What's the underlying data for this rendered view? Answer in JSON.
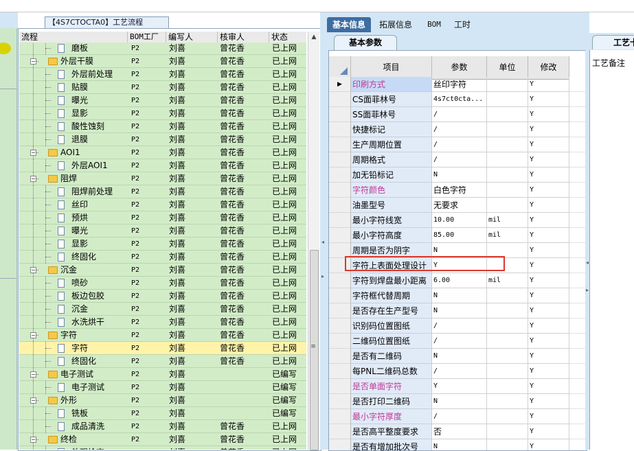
{
  "left_panel": {
    "tab_title": "【4S7CTOCTA0】工艺流程"
  },
  "tree": {
    "headers": [
      "流程",
      "BOM工厂",
      "编写人",
      "核审人",
      "状态"
    ],
    "rows": [
      {
        "level": 2,
        "kind": "doc",
        "name": "磨板",
        "bom": "P2",
        "author": "刘喜",
        "reviewer": "曾花香",
        "status": "已上网"
      },
      {
        "level": 1,
        "kind": "folder",
        "name": "外层干膜",
        "bom": "P2",
        "author": "刘喜",
        "reviewer": "曾花香",
        "status": "已上网"
      },
      {
        "level": 2,
        "kind": "doc",
        "name": "外层前处理",
        "bom": "P2",
        "author": "刘喜",
        "reviewer": "曾花香",
        "status": "已上网"
      },
      {
        "level": 2,
        "kind": "doc",
        "name": "贴膜",
        "bom": "P2",
        "author": "刘喜",
        "reviewer": "曾花香",
        "status": "已上网"
      },
      {
        "level": 2,
        "kind": "doc",
        "name": "曝光",
        "bom": "P2",
        "author": "刘喜",
        "reviewer": "曾花香",
        "status": "已上网"
      },
      {
        "level": 2,
        "kind": "doc",
        "name": "显影",
        "bom": "P2",
        "author": "刘喜",
        "reviewer": "曾花香",
        "status": "已上网"
      },
      {
        "level": 2,
        "kind": "doc",
        "name": "酸性蚀刻",
        "bom": "P2",
        "author": "刘喜",
        "reviewer": "曾花香",
        "status": "已上网"
      },
      {
        "level": 2,
        "kind": "doc",
        "name": "退膜",
        "bom": "P2",
        "author": "刘喜",
        "reviewer": "曾花香",
        "status": "已上网"
      },
      {
        "level": 1,
        "kind": "folder",
        "name": "AOI1",
        "bom": "P2",
        "author": "刘喜",
        "reviewer": "曾花香",
        "status": "已上网"
      },
      {
        "level": 2,
        "kind": "doc",
        "name": "外层AOI1",
        "bom": "P2",
        "author": "刘喜",
        "reviewer": "曾花香",
        "status": "已上网"
      },
      {
        "level": 1,
        "kind": "folder",
        "name": "阻焊",
        "bom": "P2",
        "author": "刘喜",
        "reviewer": "曾花香",
        "status": "已上网"
      },
      {
        "level": 2,
        "kind": "doc",
        "name": "阻焊前处理",
        "bom": "P2",
        "author": "刘喜",
        "reviewer": "曾花香",
        "status": "已上网"
      },
      {
        "level": 2,
        "kind": "doc",
        "name": "丝印",
        "bom": "P2",
        "author": "刘喜",
        "reviewer": "曾花香",
        "status": "已上网"
      },
      {
        "level": 2,
        "kind": "doc",
        "name": "预烘",
        "bom": "P2",
        "author": "刘喜",
        "reviewer": "曾花香",
        "status": "已上网"
      },
      {
        "level": 2,
        "kind": "doc",
        "name": "曝光",
        "bom": "P2",
        "author": "刘喜",
        "reviewer": "曾花香",
        "status": "已上网"
      },
      {
        "level": 2,
        "kind": "doc",
        "name": "显影",
        "bom": "P2",
        "author": "刘喜",
        "reviewer": "曾花香",
        "status": "已上网"
      },
      {
        "level": 2,
        "kind": "doc",
        "name": "终固化",
        "bom": "P2",
        "author": "刘喜",
        "reviewer": "曾花香",
        "status": "已上网"
      },
      {
        "level": 1,
        "kind": "folder",
        "name": "沉金",
        "bom": "P2",
        "author": "刘喜",
        "reviewer": "曾花香",
        "status": "已上网"
      },
      {
        "level": 2,
        "kind": "doc",
        "name": "喷砂",
        "bom": "P2",
        "author": "刘喜",
        "reviewer": "曾花香",
        "status": "已上网"
      },
      {
        "level": 2,
        "kind": "doc",
        "name": "板边包胶",
        "bom": "P2",
        "author": "刘喜",
        "reviewer": "曾花香",
        "status": "已上网"
      },
      {
        "level": 2,
        "kind": "doc",
        "name": "沉金",
        "bom": "P2",
        "author": "刘喜",
        "reviewer": "曾花香",
        "status": "已上网"
      },
      {
        "level": 2,
        "kind": "doc",
        "name": "水洗烘干",
        "bom": "P2",
        "author": "刘喜",
        "reviewer": "曾花香",
        "status": "已上网"
      },
      {
        "level": 1,
        "kind": "folder",
        "name": "字符",
        "bom": "P2",
        "author": "刘喜",
        "reviewer": "曾花香",
        "status": "已上网"
      },
      {
        "level": 2,
        "kind": "doc",
        "name": "字符",
        "bom": "P2",
        "author": "刘喜",
        "reviewer": "曾花香",
        "status": "已上网",
        "selected": true
      },
      {
        "level": 2,
        "kind": "doc",
        "name": "终固化",
        "bom": "P2",
        "author": "刘喜",
        "reviewer": "曾花香",
        "status": "已上网"
      },
      {
        "level": 1,
        "kind": "folder",
        "name": "电子测试",
        "bom": "P2",
        "author": "刘喜",
        "reviewer": "",
        "status": "已编写"
      },
      {
        "level": 2,
        "kind": "doc",
        "name": "电子测试",
        "bom": "P2",
        "author": "刘喜",
        "reviewer": "",
        "status": "已编写"
      },
      {
        "level": 1,
        "kind": "folder",
        "name": "外形",
        "bom": "P2",
        "author": "刘喜",
        "reviewer": "",
        "status": "已编写"
      },
      {
        "level": 2,
        "kind": "doc",
        "name": "铣板",
        "bom": "P2",
        "author": "刘喜",
        "reviewer": "",
        "status": "已编写"
      },
      {
        "level": 2,
        "kind": "doc",
        "name": "成品清洗",
        "bom": "P2",
        "author": "刘喜",
        "reviewer": "曾花香",
        "status": "已上网"
      },
      {
        "level": 1,
        "kind": "folder",
        "name": "终检",
        "bom": "P2",
        "author": "刘喜",
        "reviewer": "曾花香",
        "status": "已上网"
      },
      {
        "level": 2,
        "kind": "doc",
        "name": "外观检查",
        "bom": "P2",
        "author": "刘喜",
        "reviewer": "曾花香",
        "status": "已上网"
      }
    ]
  },
  "right_panel": {
    "tabs": [
      "基本信息",
      "拓展信息",
      "BOM",
      "工时"
    ],
    "subtab": "基本参数",
    "grid_headers": [
      "项目",
      "参数",
      "单位",
      "修改"
    ],
    "rows": [
      {
        "item": "印刷方式",
        "param": "丝印字符",
        "unit": "",
        "mod": "Y",
        "pink": true,
        "current": true
      },
      {
        "item": "CS面菲林号",
        "param": "4s7ct0cta...",
        "unit": "",
        "mod": "Y",
        "pink": false
      },
      {
        "item": "SS面菲林号",
        "param": "/",
        "unit": "",
        "mod": "Y",
        "pink": false
      },
      {
        "item": "快捷标记",
        "param": "/",
        "unit": "",
        "mod": "Y",
        "pink": false
      },
      {
        "item": "生产周期位置",
        "param": "/",
        "unit": "",
        "mod": "Y",
        "pink": false
      },
      {
        "item": "周期格式",
        "param": "/",
        "unit": "",
        "mod": "Y",
        "pink": false
      },
      {
        "item": "加无铅标记",
        "param": "N",
        "unit": "",
        "mod": "Y",
        "pink": false
      },
      {
        "item": "字符颜色",
        "param": "白色字符",
        "unit": "",
        "mod": "Y",
        "pink": true
      },
      {
        "item": "油墨型号",
        "param": "无要求",
        "unit": "",
        "mod": "Y",
        "pink": false
      },
      {
        "item": "最小字符线宽",
        "param": "10.00",
        "unit": "mil",
        "mod": "Y",
        "pink": false
      },
      {
        "item": "最小字符高度",
        "param": "85.00",
        "unit": "mil",
        "mod": "Y",
        "pink": false
      },
      {
        "item": "周期是否为阴字",
        "param": "N",
        "unit": "",
        "mod": "Y",
        "pink": false
      },
      {
        "item": "字符上表面处理设计",
        "param": "Y",
        "unit": "",
        "mod": "Y",
        "pink": false,
        "highlight": true
      },
      {
        "item": "字符到焊盘最小距离",
        "param": "6.00",
        "unit": "mil",
        "mod": "Y",
        "pink": false
      },
      {
        "item": "字符框代替周期",
        "param": "N",
        "unit": "",
        "mod": "Y",
        "pink": false
      },
      {
        "item": "是否存在生产型号",
        "param": "N",
        "unit": "",
        "mod": "Y",
        "pink": false
      },
      {
        "item": "识别码位置图纸",
        "param": "/",
        "unit": "",
        "mod": "Y",
        "pink": false
      },
      {
        "item": "二维码位置图纸",
        "param": "/",
        "unit": "",
        "mod": "Y",
        "pink": false
      },
      {
        "item": "是否有二维码",
        "param": "N",
        "unit": "",
        "mod": "Y",
        "pink": false
      },
      {
        "item": "每PNL二维码总数",
        "param": "/",
        "unit": "",
        "mod": "Y",
        "pink": false
      },
      {
        "item": "是否单面字符",
        "param": "Y",
        "unit": "",
        "mod": "Y",
        "pink": true
      },
      {
        "item": "是否打印二维码",
        "param": "N",
        "unit": "",
        "mod": "Y",
        "pink": false
      },
      {
        "item": "最小字符厚度",
        "param": "/",
        "unit": "",
        "mod": "Y",
        "pink": true
      },
      {
        "item": "是否高平整度要求",
        "param": "否",
        "unit": "",
        "mod": "Y",
        "pink": false
      },
      {
        "item": "是否有增加批次号",
        "param": "N",
        "unit": "",
        "mod": "Y",
        "pink": false
      }
    ]
  },
  "far_right": {
    "tab": "工艺卡",
    "label": "工艺备注"
  },
  "colors": {
    "tree_bg": "#d2ecc8",
    "selected_row": "#fff3a8",
    "tab_active": "#3e6da3",
    "pink_text": "#c0389b",
    "highlight_box": "#d83a2c"
  }
}
